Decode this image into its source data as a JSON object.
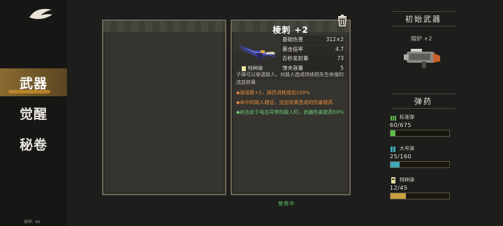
{
  "sidebar": {
    "nav": [
      {
        "label": "武器",
        "active": true
      },
      {
        "label": "觉醒",
        "active": false
      },
      {
        "label": "秘卷",
        "active": false
      }
    ],
    "fps": "帧率: 46"
  },
  "weapon_detail": {
    "title": "棱刺 +2",
    "stats": [
      {
        "label": "基础伤害",
        "value": "312×2"
      },
      {
        "label": "暴击倍率",
        "value": "4.7"
      },
      {
        "label": "百秒发射量",
        "value": "73"
      },
      {
        "label": "弹夹容量",
        "value": "5"
      }
    ],
    "ammo_type": "特种弹",
    "description": "子弹可以穿透敌人，对敌人造成持续损失生命值的流血效果",
    "bullets": [
      {
        "text": "◆弹道数+1，弹药消耗增加100%",
        "color": "orange"
      },
      {
        "text": "◆命中的敌人越远，流血效果造成的伤害越高",
        "color": "orange"
      },
      {
        "text": "◆射击处于电击异常的敌人时，武器伤害提高50%",
        "color": "green"
      }
    ],
    "status": "使用中"
  },
  "starting_weapon": {
    "header": "初始武器",
    "name": "熔炉 +2"
  },
  "ammo": {
    "header": "弹药",
    "items": [
      {
        "name": "标准弹",
        "count": "60/675",
        "current": 60,
        "max": 675,
        "color": "#5cbf4a",
        "icon": "standard-ammo-icon"
      },
      {
        "name": "大号弹",
        "count": "25/160",
        "current": 25,
        "max": 160,
        "color": "#3fa8b8",
        "icon": "large-ammo-icon"
      },
      {
        "name": "特种弹",
        "count": "12/45",
        "current": 12,
        "max": 45,
        "color": "#c9a040",
        "icon": "special-ammo-icon"
      }
    ]
  }
}
